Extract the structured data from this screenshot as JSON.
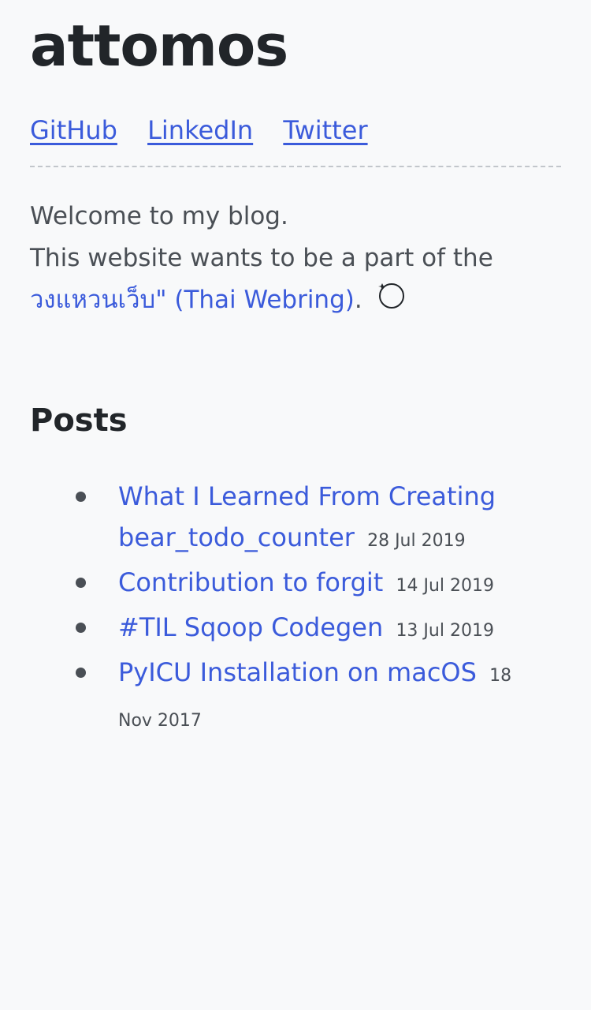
{
  "site": {
    "title": "attomos"
  },
  "social_links": [
    {
      "label": "GitHub"
    },
    {
      "label": "LinkedIn"
    },
    {
      "label": "Twitter"
    }
  ],
  "intro": {
    "welcome": "Welcome to my blog.",
    "webring_prefix": "This website wants to be a part of the",
    "webring_link": "วงแหวนเว็บ\" (Thai Webring)",
    "webring_suffix": ".",
    "webring_icon": "ring-icon"
  },
  "posts": {
    "heading": "Posts",
    "items": [
      {
        "title": "What I Learned From Creating bear_todo_counter",
        "date": "28 Jul 2019"
      },
      {
        "title": "Contribution to forgit",
        "date": "14 Jul 2019"
      },
      {
        "title": "#TIL Sqoop Codegen",
        "date": "13 Jul 2019"
      },
      {
        "title": "PyICU Installation on macOS",
        "date": "18 Nov 2017"
      }
    ]
  },
  "colors": {
    "link": "#3b5bdb",
    "heading": "#212529",
    "text": "#4a4f55",
    "background": "#f8f9fa"
  }
}
